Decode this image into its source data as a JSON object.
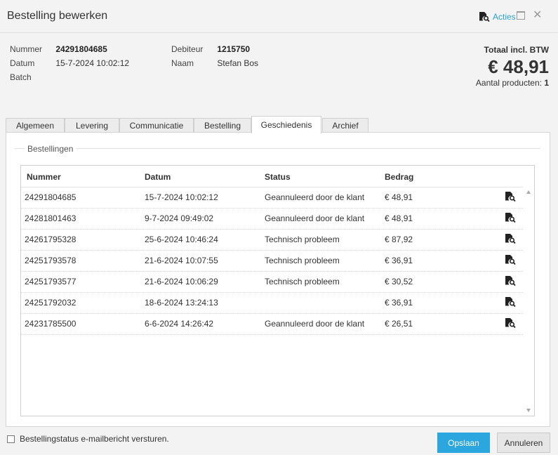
{
  "dialog": {
    "title": "Bestelling bewerken",
    "actions_label": "Acties",
    "close_glyph": "✕",
    "icons": {
      "actions": "document-search-icon",
      "maximize": "maximize-icon",
      "close": "close-icon"
    }
  },
  "order": {
    "number_label": "Nummer",
    "number_value": "24291804685",
    "date_label": "Datum",
    "date_value": "15-7-2024 10:02:12",
    "batch_label": "Batch",
    "debtor_label": "Debiteur",
    "debtor_value": "1215750",
    "name_label": "Naam",
    "name_value": "Stefan Bos"
  },
  "totals": {
    "label": "Totaal incl. BTW",
    "amount": "€ 48,91",
    "count_label": "Aantal producten:",
    "count_value": "1"
  },
  "tabs": [
    {
      "label": "Algemeen",
      "active": false
    },
    {
      "label": "Levering",
      "active": false
    },
    {
      "label": "Communicatie",
      "active": false
    },
    {
      "label": "Bestelling",
      "active": false
    },
    {
      "label": "Geschiedenis",
      "active": true
    },
    {
      "label": "Archief",
      "active": false
    }
  ],
  "history": {
    "section_title": "Bestellingen",
    "columns": [
      "Nummer",
      "Datum",
      "Status",
      "Bedrag"
    ],
    "rows": [
      {
        "number": "24291804685",
        "date": "15-7-2024 10:02:12",
        "status": "Geannuleerd door de klant",
        "amount": "€ 48,91"
      },
      {
        "number": "24281801463",
        "date": "9-7-2024 09:49:02",
        "status": "Geannuleerd door de klant",
        "amount": "€ 48,91"
      },
      {
        "number": "24261795328",
        "date": "25-6-2024 10:46:24",
        "status": "Technisch probleem",
        "amount": "€ 87,92"
      },
      {
        "number": "24251793578",
        "date": "21-6-2024 10:07:55",
        "status": "Technisch probleem",
        "amount": "€ 36,91"
      },
      {
        "number": "24251793577",
        "date": "21-6-2024 10:06:29",
        "status": "Technisch probleem",
        "amount": "€ 30,52"
      },
      {
        "number": "24251792032",
        "date": "18-6-2024 13:24:13",
        "status": "",
        "amount": "€ 36,91"
      },
      {
        "number": "24231785500",
        "date": "6-6-2024 14:26:42",
        "status": "Geannuleerd door de klant",
        "amount": "€ 26,51"
      }
    ],
    "row_icon": "document-search-icon"
  },
  "footer": {
    "email_checkbox_label": "Bestellingstatus e-mailbericht versturen.",
    "email_checkbox_checked": false,
    "save_label": "Opslaan",
    "cancel_label": "Annuleren"
  },
  "colors": {
    "accent": "#2ba6df",
    "link": "#2ba2d6"
  }
}
